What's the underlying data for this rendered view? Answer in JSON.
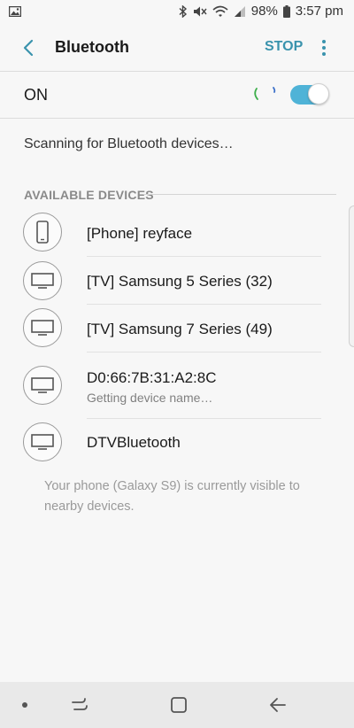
{
  "status_bar": {
    "battery": "98%",
    "time": "3:57 pm"
  },
  "header": {
    "title": "Bluetooth",
    "stop_label": "STOP"
  },
  "toggle_row": {
    "label": "ON",
    "enabled": true
  },
  "scanning_text": "Scanning for Bluetooth devices…",
  "available_section": {
    "title": "AVAILABLE DEVICES",
    "devices": [
      {
        "name": "[Phone] reyface",
        "icon": "phone-icon"
      },
      {
        "name": "[TV] Samsung 5 Series (32)",
        "icon": "tv-icon"
      },
      {
        "name": "[TV] Samsung 7 Series (49)",
        "icon": "tv-icon"
      },
      {
        "name": "D0:66:7B:31:A2:8C",
        "subtitle": "Getting device name…",
        "icon": "tv-icon"
      },
      {
        "name": "DTVBluetooth",
        "icon": "tv-icon"
      }
    ]
  },
  "visibility_note": "Your phone (Galaxy S9) is currently visible to nearby devices.",
  "colors": {
    "accent": "#3a93ad",
    "toggle_on": "#4fb3d7",
    "background": "#f7f7f7"
  }
}
